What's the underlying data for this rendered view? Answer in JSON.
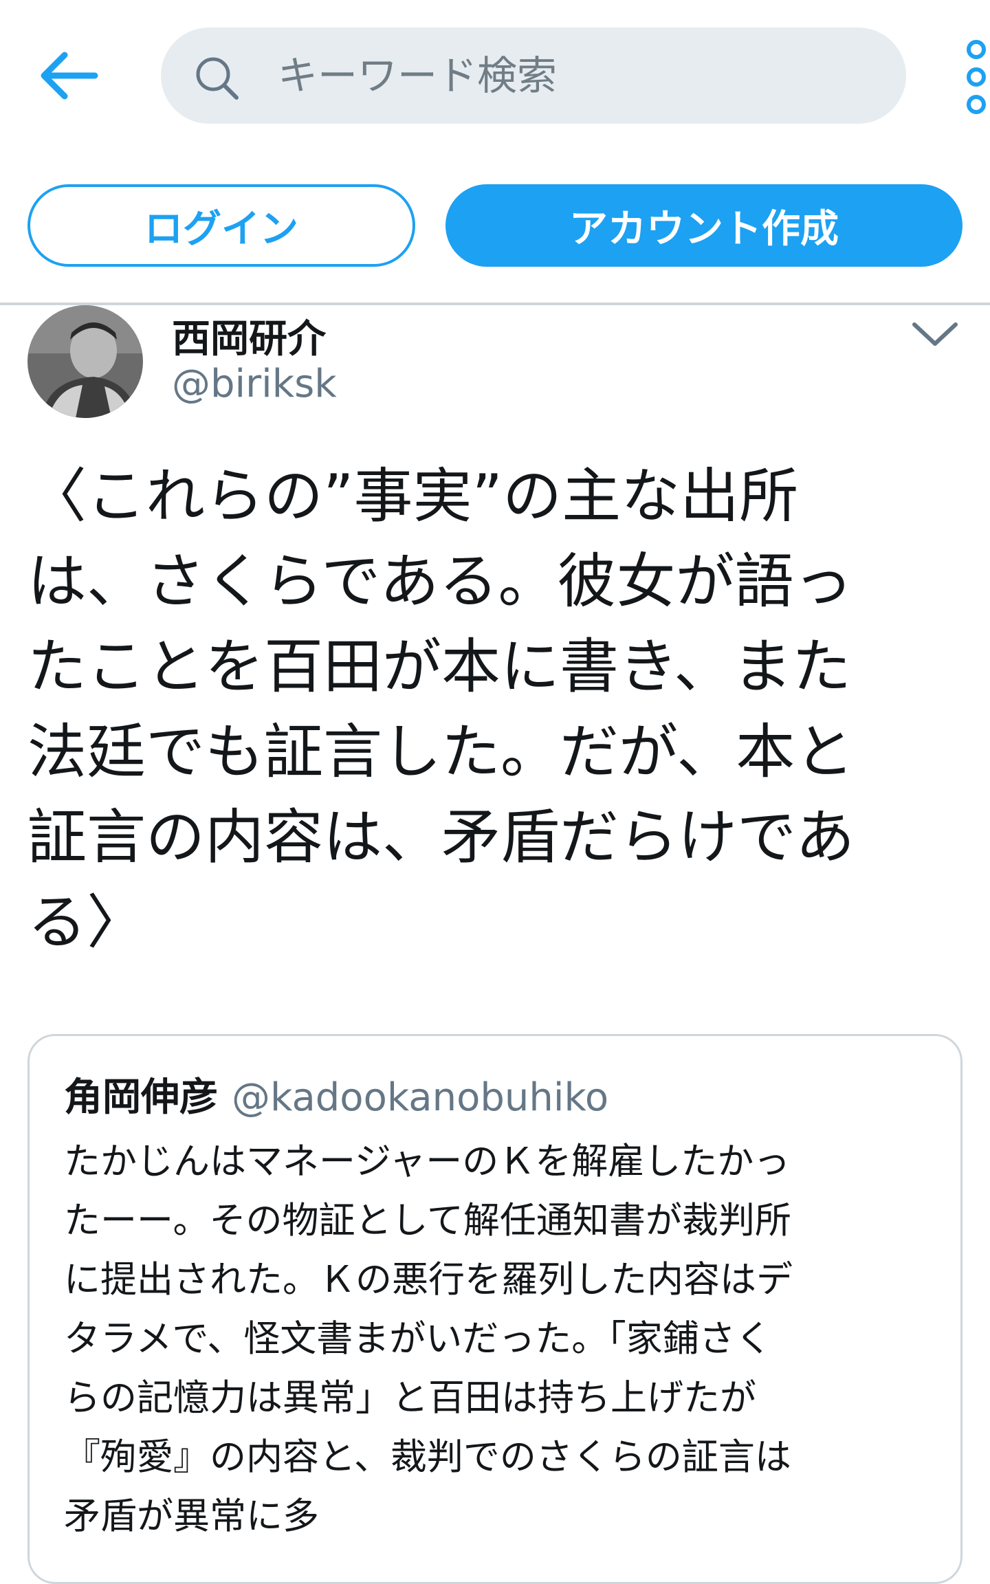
{
  "header": {
    "search_placeholder": "キーワード検索",
    "back_icon": "arrow-left-icon",
    "more_icon": "more-vertical-icon",
    "accent_color": "#1da1f2"
  },
  "auth": {
    "login_label": "ログイン",
    "signup_label": "アカウント作成"
  },
  "tweet": {
    "display_name": "西岡研介",
    "handle": "@biriksk",
    "text_lines": [
      "〈これらの”事実”の主な出所",
      "は、さくらである。彼女が語っ",
      "たことを百田が本に書き、また",
      "法廷でも証言した。だが、本と",
      "証言の内容は、矛盾だらけであ",
      "る〉"
    ]
  },
  "quoted_tweet": {
    "display_name": "角岡伸彦",
    "handle": "@kadookanobuhiko",
    "text_lines": [
      "たかじんはマネージャーのＫを解雇したかっ",
      "たーー。その物証として解任通知書が裁判所",
      "に提出された。Ｋの悪行を羅列した内容はデ",
      "タラメで、怪文書まがいだった。「家鋪さく",
      "らの記憶力は異常」と百田は持ち上げたが",
      "『殉愛』の内容と、裁判でのさくらの証言は",
      "矛盾が異常に多"
    ]
  }
}
